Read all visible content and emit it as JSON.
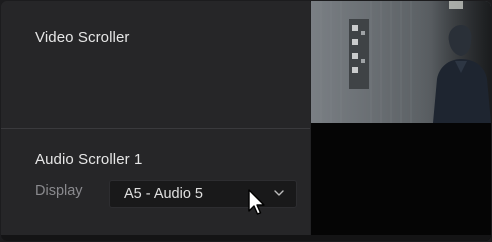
{
  "panels": {
    "video": {
      "title": "Video Scroller"
    },
    "audio": {
      "title": "Audio Scroller 1",
      "display_label": "Display",
      "display_selected": "A5 - Audio 5"
    }
  },
  "icons": {
    "dropdown": "chevron-down-icon",
    "cursor": "mouse-pointer-icon"
  },
  "colors": {
    "panel_bg": "#262628",
    "dropdown_bg": "#19191a",
    "title_text": "#e6e6e6",
    "label_text": "#8a8a8e"
  }
}
